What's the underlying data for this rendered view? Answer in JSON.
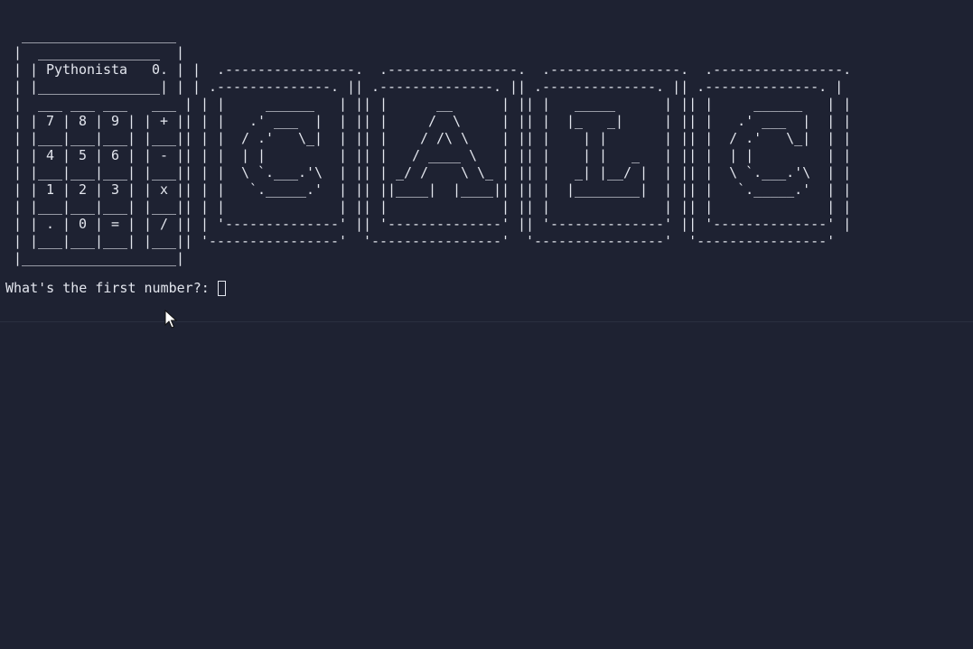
{
  "terminal": {
    "ascii_banner": "  ___________________\n |  _______________  |\n | | Pythonista   0. | |  .----------------.  .----------------.  .----------------.  .----------------.\n | |_______________| | | .--------------. || .--------------. || .--------------. || .--------------. |\n |  ___ ___ ___   ___ | | |     ______   | || |      __      | || |   _____      | || |     ______   | |\n | | 7 | 8 | 9 | | + || | |   .' ___  |  | || |     /  \\     | || |  |_   _|     | || |   .' ___  |  | |\n | |___|___|___| |___|| | |  / .'   \\_|  | || |    / /\\ \\    | || |    | |       | || |  / .'   \\_|  | |\n | | 4 | 5 | 6 | | - || | |  | |         | || |   / ____ \\   | || |    | |   _   | || |  | |         | |\n | |___|___|___| |___|| | |  \\ `.___.'\\  | || | _/ /    \\ \\_ | || |   _| |__/ |  | || |  \\ `.___.'\\  | |\n | | 1 | 2 | 3 | | x || | |   `._____.'  | || ||____|  |____|| || |  |________|  | || |   `._____.'  | |\n | |___|___|___| |___|| | |              | || |              | || |              | || |              | |\n | | . | 0 | = | | / || | '--------------' || '--------------' || '--------------' || '--------------' |\n | |___|___|___| |___|| '----------------'  '----------------'  '----------------'  '----------------'\n |___________________|",
    "prompt": "What's the first number?:"
  },
  "colors": {
    "background": "#1e2232",
    "foreground": "#e3e6ee",
    "divider": "#2a2f40"
  },
  "icons": {
    "cursor": "text-cursor-box",
    "pointer": "mouse-pointer-icon"
  }
}
